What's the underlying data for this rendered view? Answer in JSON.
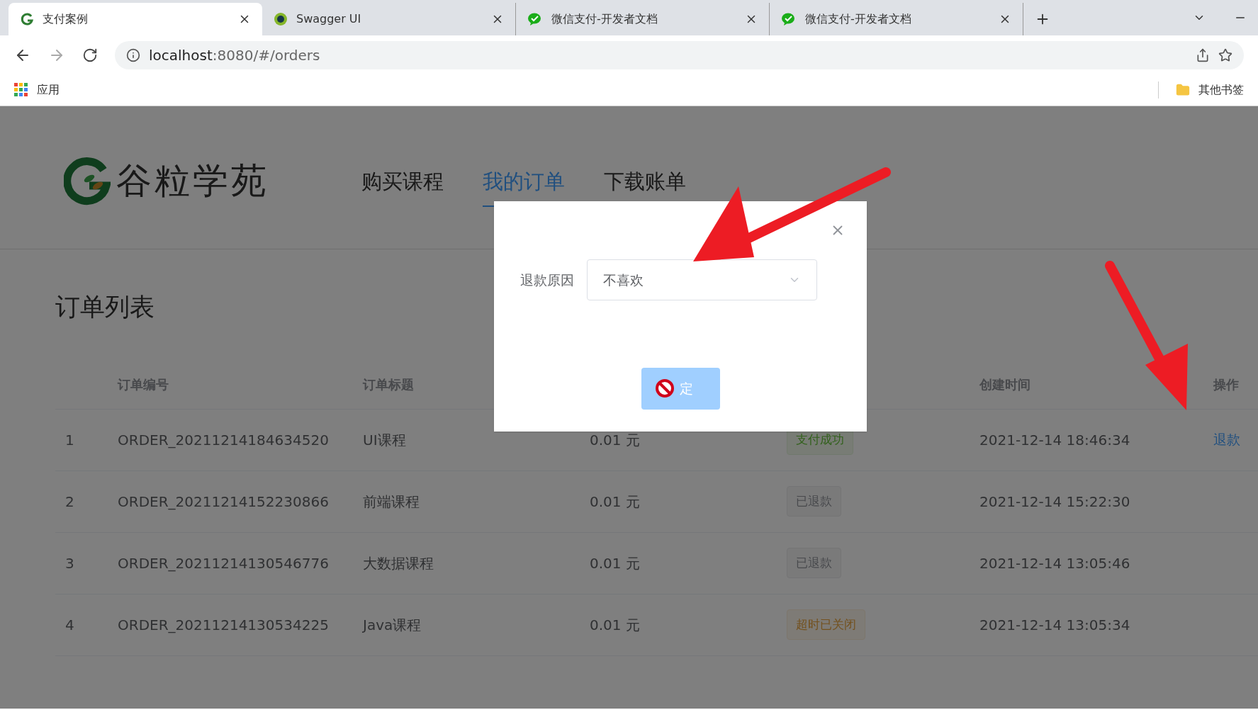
{
  "browser": {
    "tabs": [
      {
        "title": "支付案例",
        "selected": true,
        "kind": "g"
      },
      {
        "title": "Swagger UI",
        "selected": false,
        "kind": "swagger"
      },
      {
        "title": "微信支付-开发者文档",
        "selected": false,
        "kind": "wechat"
      },
      {
        "title": "微信支付-开发者文档",
        "selected": false,
        "kind": "wechat"
      }
    ],
    "address": {
      "host": "localhost",
      "rest": ":8080/#/orders"
    },
    "bookmarks": {
      "apps": "应用",
      "other": "其他书签"
    }
  },
  "site": {
    "logo_text": "谷粒学苑",
    "nav": [
      {
        "label": "购买课程",
        "selected": false
      },
      {
        "label": "我的订单",
        "selected": true
      },
      {
        "label": "下载账单",
        "selected": false
      }
    ]
  },
  "page_title": "订单列表",
  "table": {
    "header": {
      "order_no": "订单编号",
      "title": "订单标题",
      "created": "创建时间",
      "action": "操作"
    },
    "rows": [
      {
        "index": "1",
        "order_no": "ORDER_20211214184634520",
        "title": "UI课程",
        "amount": "0.01 元",
        "status": "支付成功",
        "kind": "success",
        "created": "2021-12-14 18:46:34",
        "action": "退款"
      },
      {
        "index": "2",
        "order_no": "ORDER_20211214152230866",
        "title": "前端课程",
        "amount": "0.01 元",
        "status": "已退款",
        "kind": "refunded",
        "created": "2021-12-14 15:22:30"
      },
      {
        "index": "3",
        "order_no": "ORDER_20211214130546776",
        "title": "大数据课程",
        "amount": "0.01 元",
        "status": "已退款",
        "kind": "refunded",
        "created": "2021-12-14 13:05:46"
      },
      {
        "index": "4",
        "order_no": "ORDER_20211214130534225",
        "title": "Java课程",
        "amount": "0.01 元",
        "status": "超时已关闭",
        "kind": "closed",
        "created": "2021-12-14 13:05:34"
      }
    ]
  },
  "dialog": {
    "field_label": "退款原因",
    "select_value": "不喜欢",
    "confirm": "定"
  }
}
